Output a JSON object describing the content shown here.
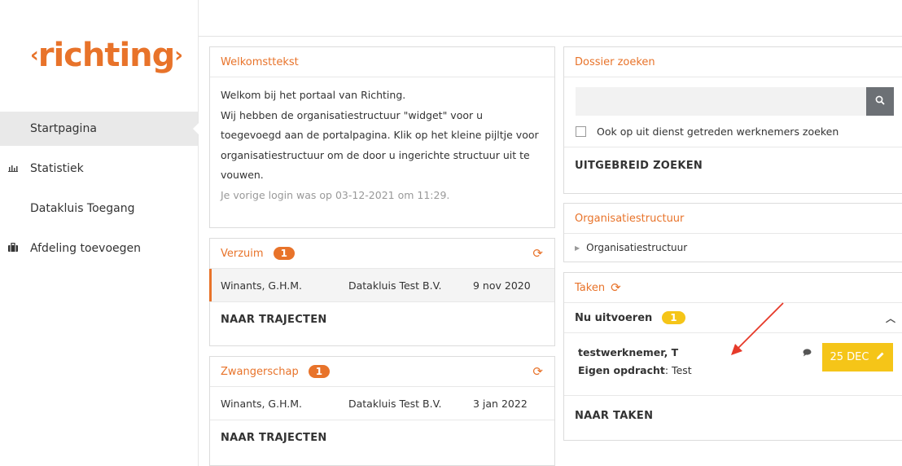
{
  "logo": {
    "text": "richting",
    "left": "‹",
    "right": "›"
  },
  "nav": [
    {
      "label": "Startpagina",
      "icon": "",
      "active": true
    },
    {
      "label": "Statistiek",
      "icon": "chart-icon"
    },
    {
      "label": "Datakluis Toegang",
      "icon": ""
    },
    {
      "label": "Afdeling toevoegen",
      "icon": "briefcase-icon"
    }
  ],
  "welcome": {
    "title": "Welkomsttekst",
    "line1": "Welkom bij het portaal van Richting.",
    "line2": "Wij hebben de organisatiestructuur \"widget\" voor u toegevoegd aan de portalpagina. Klik op het kleine pijltje voor organisatiestructuur om de door u ingerichte structuur uit te vouwen.",
    "last_login": "Je vorige login was op 03-12-2021 om 11:29."
  },
  "verzuim": {
    "title": "Verzuim",
    "count": "1",
    "row": {
      "name": "Winants, G.H.M.",
      "company": "Datakluis Test B.V.",
      "date": "9 nov 2020"
    },
    "link": "NAAR TRAJECTEN"
  },
  "zwangerschap": {
    "title": "Zwangerschap",
    "count": "1",
    "row": {
      "name": "Winants, G.H.M.",
      "company": "Datakluis Test B.V.",
      "date": "3 jan 2022"
    },
    "link": "NAAR TRAJECTEN"
  },
  "dossier": {
    "title": "Dossier zoeken",
    "search_placeholder": "",
    "checkbox_label": "Ook op uit dienst getreden werknemers zoeken",
    "advanced": "UITGEBREID ZOEKEN"
  },
  "org": {
    "title": "Organisatiestructuur",
    "item": "Organisatiestructuur"
  },
  "taken": {
    "title": "Taken",
    "group": "Nu uitvoeren",
    "count": "1",
    "task": {
      "name": "testwerknemer, T",
      "label": "Eigen opdracht",
      "value": ": Test",
      "date": "25 DEC"
    },
    "link": "NAAR TAKEN"
  },
  "colors": {
    "accent": "#e8732a",
    "yellow": "#f5c518"
  }
}
